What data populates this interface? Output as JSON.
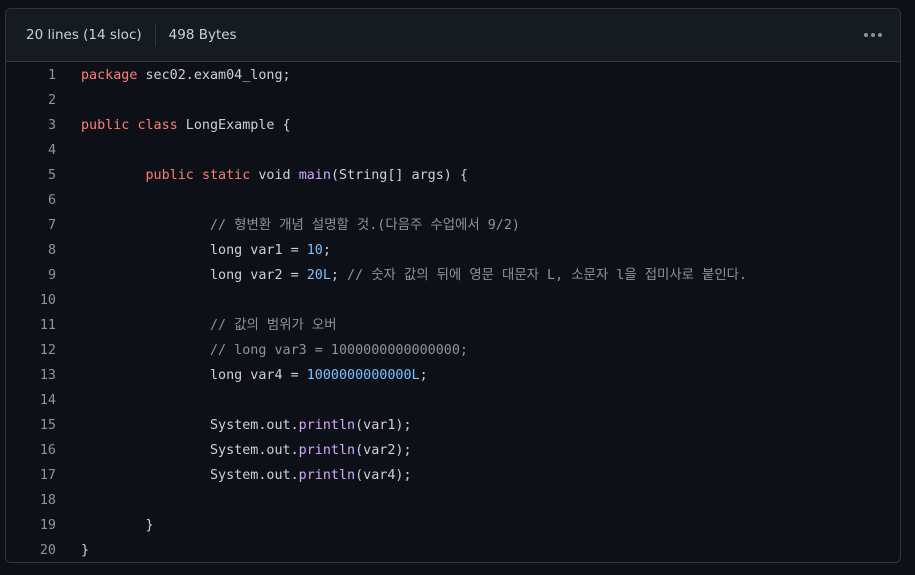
{
  "header": {
    "lines_info": "20 lines (14 sloc)",
    "size_info": "498 Bytes"
  },
  "icons": {
    "more": "kebab-horizontal-icon"
  },
  "colors": {
    "background": "#0d1117",
    "header_bg": "#161b22",
    "border": "#30363d",
    "keyword": "#ff7b72",
    "function": "#d2a8ff",
    "number": "#79c0ff",
    "comment": "#8b949e",
    "text": "#c9d1d9"
  },
  "code": {
    "lines": [
      {
        "n": "1",
        "tokens": [
          {
            "t": "package",
            "c": "kw"
          },
          {
            "t": " sec02.exam04_long;"
          }
        ]
      },
      {
        "n": "2",
        "tokens": []
      },
      {
        "n": "3",
        "tokens": [
          {
            "t": "public",
            "c": "kw"
          },
          {
            "t": " "
          },
          {
            "t": "class",
            "c": "kw"
          },
          {
            "t": " LongExample {"
          }
        ]
      },
      {
        "n": "4",
        "tokens": []
      },
      {
        "n": "5",
        "tokens": [
          {
            "t": "\t"
          },
          {
            "t": "public",
            "c": "kw"
          },
          {
            "t": " "
          },
          {
            "t": "static",
            "c": "kw"
          },
          {
            "t": " void "
          },
          {
            "t": "main",
            "c": "fn"
          },
          {
            "t": "(String[] args) {"
          }
        ]
      },
      {
        "n": "6",
        "tokens": []
      },
      {
        "n": "7",
        "tokens": [
          {
            "t": "\t\t"
          },
          {
            "t": "// 형변환 개념 설명할 것.(다음주 수업에서 9/2)",
            "c": "cm"
          }
        ]
      },
      {
        "n": "8",
        "tokens": [
          {
            "t": "\t\tlong var1 = "
          },
          {
            "t": "10",
            "c": "num"
          },
          {
            "t": ";"
          }
        ]
      },
      {
        "n": "9",
        "tokens": [
          {
            "t": "\t\tlong var2 = "
          },
          {
            "t": "20L",
            "c": "num"
          },
          {
            "t": "; "
          },
          {
            "t": "// 숫자 값의 뒤에 영문 대문자 L, 소문자 l을 접미사로 붙인다.",
            "c": "cm"
          }
        ]
      },
      {
        "n": "10",
        "tokens": []
      },
      {
        "n": "11",
        "tokens": [
          {
            "t": "\t\t"
          },
          {
            "t": "// 값의 범위가 오버",
            "c": "cm"
          }
        ]
      },
      {
        "n": "12",
        "tokens": [
          {
            "t": "\t\t"
          },
          {
            "t": "// long var3 = 1000000000000000;",
            "c": "cm"
          }
        ]
      },
      {
        "n": "13",
        "tokens": [
          {
            "t": "\t\tlong var4 = "
          },
          {
            "t": "1000000000000L",
            "c": "num"
          },
          {
            "t": ";"
          }
        ]
      },
      {
        "n": "14",
        "tokens": []
      },
      {
        "n": "15",
        "tokens": [
          {
            "t": "\t\tSystem.out."
          },
          {
            "t": "println",
            "c": "fn"
          },
          {
            "t": "(var1);"
          }
        ]
      },
      {
        "n": "16",
        "tokens": [
          {
            "t": "\t\tSystem.out."
          },
          {
            "t": "println",
            "c": "fn"
          },
          {
            "t": "(var2);"
          }
        ]
      },
      {
        "n": "17",
        "tokens": [
          {
            "t": "\t\tSystem.out."
          },
          {
            "t": "println",
            "c": "fn"
          },
          {
            "t": "(var4);"
          }
        ]
      },
      {
        "n": "18",
        "tokens": []
      },
      {
        "n": "19",
        "tokens": [
          {
            "t": "\t}"
          }
        ]
      },
      {
        "n": "20",
        "tokens": [
          {
            "t": "}"
          }
        ]
      }
    ]
  }
}
